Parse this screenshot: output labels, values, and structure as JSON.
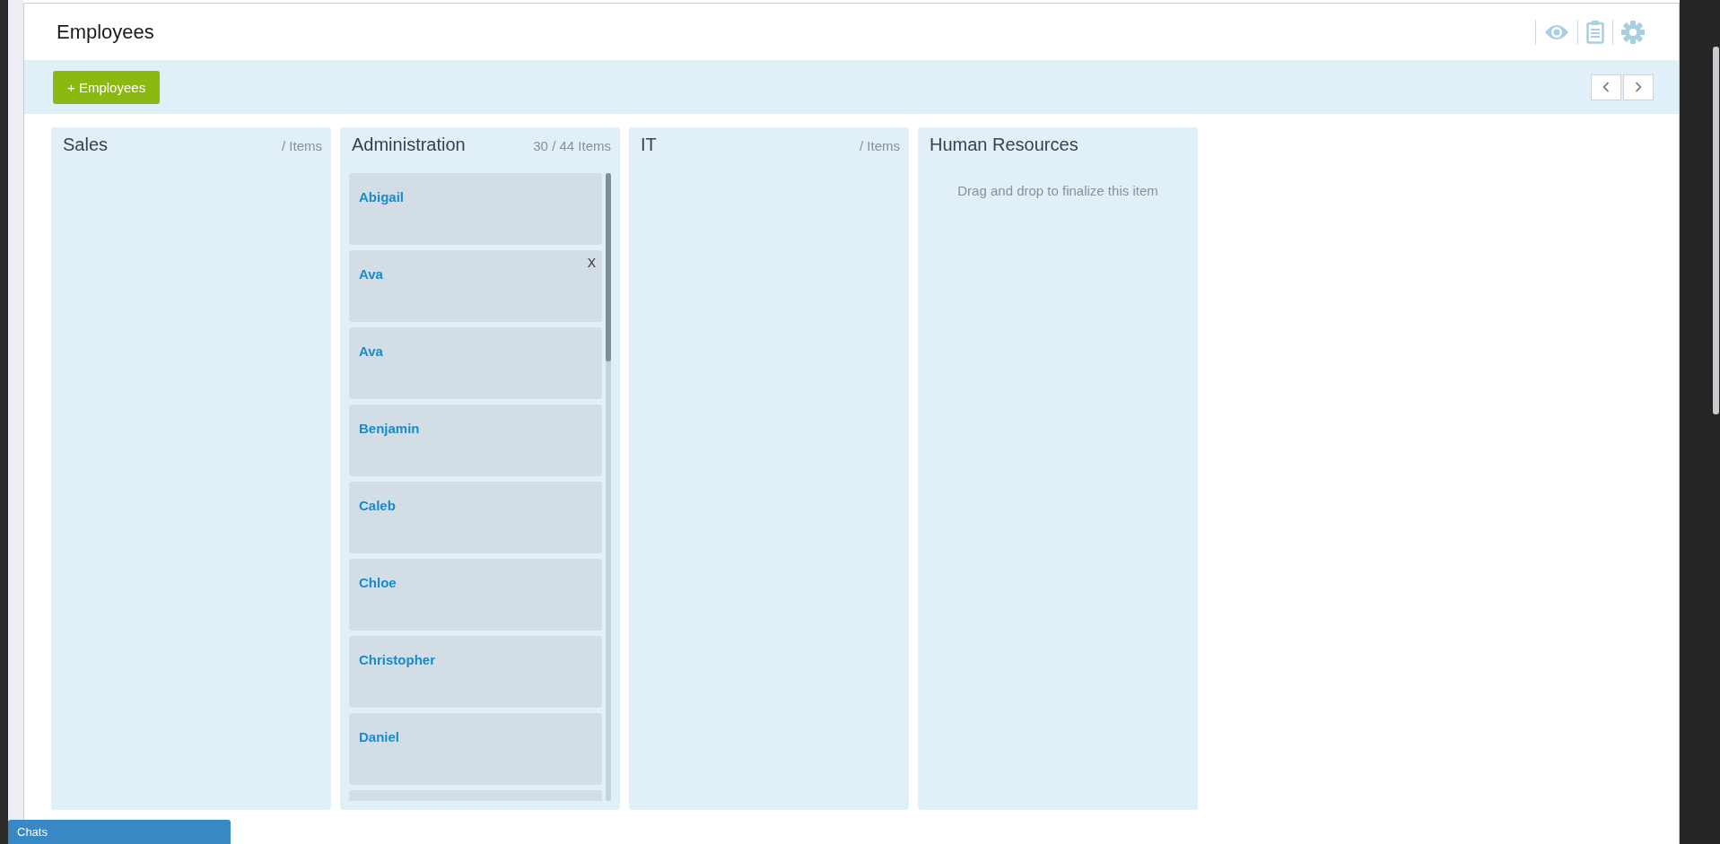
{
  "page": {
    "title": "Employees"
  },
  "toolbar": {
    "add_button": "+ Employees",
    "nav": [
      {
        "kind": "prev"
      },
      {
        "kind": "next"
      }
    ]
  },
  "header_icons": [
    {
      "kind": "eye"
    },
    {
      "kind": "clipboard"
    },
    {
      "kind": "gear"
    }
  ],
  "columns": [
    {
      "title": "Sales",
      "count": "/ Items"
    },
    {
      "title": "Administration",
      "count": "30 / 44 Items",
      "cards": [
        {
          "name": "Abigail"
        },
        {
          "name": "Ava",
          "remove": "X"
        },
        {
          "name": "Ava"
        },
        {
          "name": "Benjamin"
        },
        {
          "name": "Caleb"
        },
        {
          "name": "Chloe"
        },
        {
          "name": "Christopher"
        },
        {
          "name": "Daniel"
        }
      ]
    },
    {
      "title": "IT",
      "count": "/ Items"
    },
    {
      "title": "Human Resources",
      "hint": "Drag and drop to finalize this item"
    }
  ],
  "chat_bar": {
    "label": "Chats"
  }
}
